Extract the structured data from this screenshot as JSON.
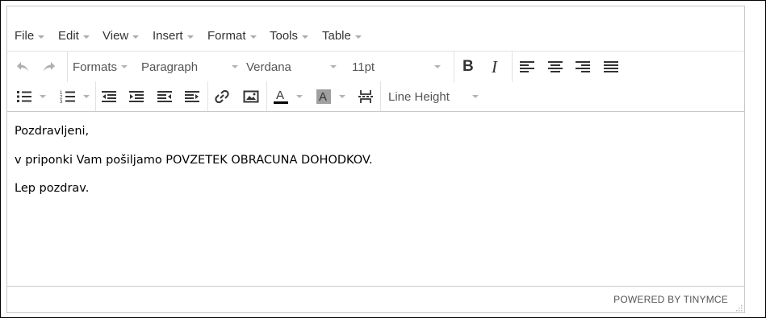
{
  "menubar": {
    "items": [
      {
        "label": "File"
      },
      {
        "label": "Edit"
      },
      {
        "label": "View"
      },
      {
        "label": "Insert"
      },
      {
        "label": "Format"
      },
      {
        "label": "Tools"
      },
      {
        "label": "Table"
      }
    ]
  },
  "toolbar": {
    "formats_label": "Formats",
    "block_format": "Paragraph",
    "font_family": "Verdana",
    "font_size": "11pt",
    "bold_label": "B",
    "italic_label": "I",
    "line_height_label": "Line Height",
    "icons": [
      "undo-icon",
      "redo-icon",
      "bold-icon",
      "italic-icon",
      "align-left-icon",
      "align-center-icon",
      "align-right-icon",
      "align-justify-icon",
      "bullet-list-icon",
      "numbered-list-icon",
      "outdent-icon",
      "indent-icon",
      "outdent-alt-icon",
      "indent-alt-icon",
      "link-icon",
      "image-icon",
      "text-color-icon",
      "background-color-icon",
      "page-break-icon"
    ]
  },
  "content": {
    "paragraphs": [
      "Pozdravljeni,",
      "v priponki Vam pošiljamo POVZETEK OBRACUNA DOHODKOV.",
      "Lep pozdrav."
    ]
  },
  "statusbar": {
    "powered_by": "POWERED BY TINYMCE"
  },
  "colors": {
    "border": "#c8c8c8",
    "icon": "#333333",
    "disabled_icon": "#b0b0b0",
    "text_color_swatch": "#000000",
    "background_color_swatch": "#a0a0a0"
  }
}
